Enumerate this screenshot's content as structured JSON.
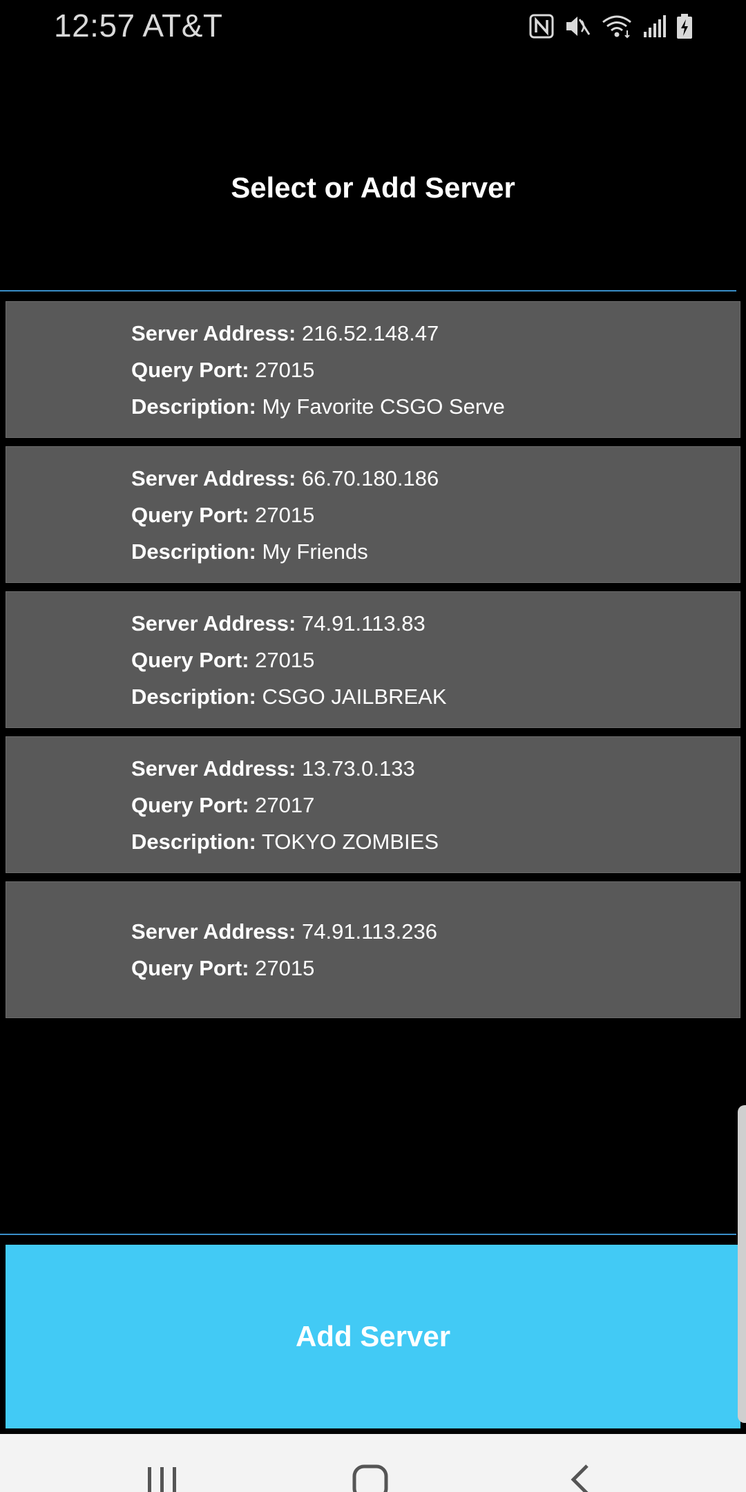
{
  "status_bar": {
    "time": "12:57 AT&T",
    "icons": [
      "nfc-icon",
      "mute-icon",
      "wifi-icon",
      "signal-icon",
      "battery-charging-icon"
    ]
  },
  "header": {
    "title": "Select or Add Server"
  },
  "labels": {
    "address": "Server Address:",
    "port": "Query Port:",
    "description": "Description:"
  },
  "servers": [
    {
      "address": "216.52.148.47",
      "port": "27015",
      "description": "My Favorite CSGO Serve"
    },
    {
      "address": "66.70.180.186",
      "port": "27015",
      "description": "My Friends"
    },
    {
      "address": "74.91.113.83",
      "port": "27015",
      "description": "CSGO JAILBREAK"
    },
    {
      "address": "13.73.0.133",
      "port": "27017",
      "description": "TOKYO ZOMBIES"
    },
    {
      "address": "74.91.113.236",
      "port": "27015"
    }
  ],
  "add_button": {
    "label": "Add Server"
  },
  "nav": {
    "icons": [
      "recent-apps-icon",
      "home-icon",
      "back-icon"
    ]
  },
  "colors": {
    "accent": "#42caf5",
    "divider": "#3a8fc9",
    "card": "#595959"
  }
}
